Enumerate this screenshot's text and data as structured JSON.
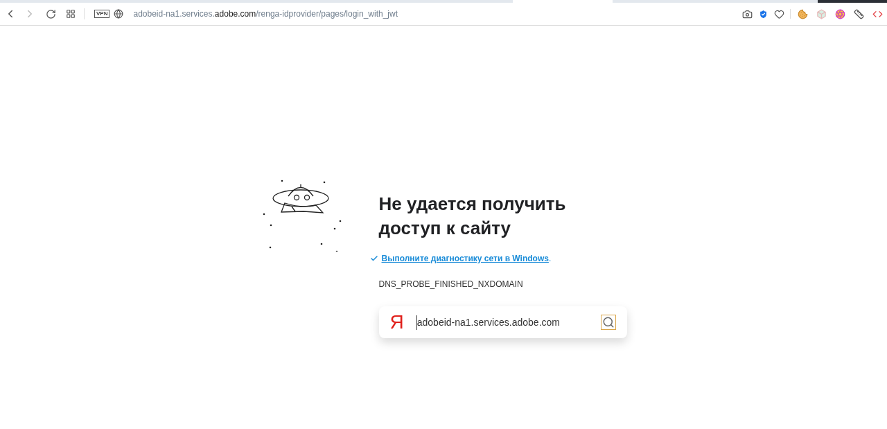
{
  "address_bar": {
    "vpn_badge": "VPN",
    "url_parts": [
      {
        "text": "adobeid-na1.services.",
        "kind": "muted"
      },
      {
        "text": "adobe.com",
        "kind": "main"
      },
      {
        "text": "/renga-idprovider/pages/login_with_jwt",
        "kind": "muted"
      }
    ]
  },
  "error": {
    "title": "Не удается получить доступ к сайту",
    "suggestion": {
      "checked": true,
      "link": "Выполните диагностику сети в Windows",
      "tail": "."
    },
    "code": "DNS_PROBE_FINISHED_NXDOMAIN"
  },
  "search": {
    "logo": "Я",
    "value": "adobeid-na1.services.adobe.com"
  }
}
